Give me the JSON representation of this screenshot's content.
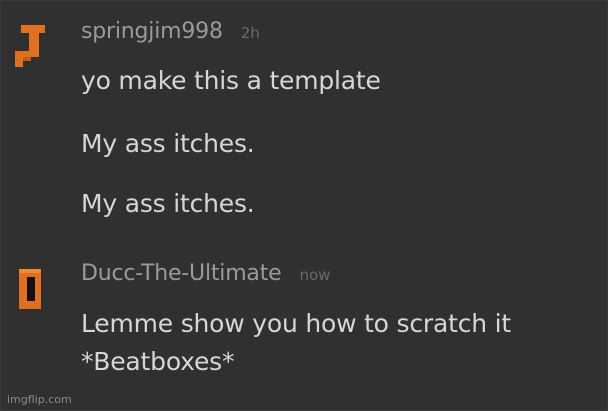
{
  "comments": [
    {
      "username": "springjim998",
      "time": "2h",
      "lines": [
        "yo make this a template",
        "My ass itches.",
        "My ass itches."
      ]
    },
    {
      "username": "Ducc-The-Ultimate",
      "time": "now",
      "lines": [
        "Lemme show you how to scratch it",
        "*Beatboxes*"
      ]
    }
  ],
  "watermark": "imgflip.com",
  "colors": {
    "background": "#303030",
    "avatar_orange": "#e07020",
    "avatar_black": "#111111"
  }
}
